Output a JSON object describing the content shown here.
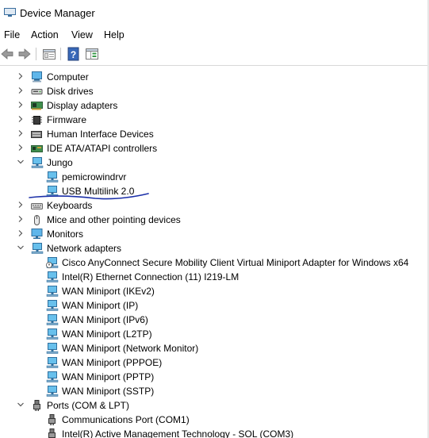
{
  "window": {
    "title": "Device Manager"
  },
  "menu": [
    "File",
    "Action",
    "View",
    "Help"
  ],
  "toolbar": {
    "buttons": [
      {
        "icon": "back-arrow-icon"
      },
      {
        "icon": "forward-arrow-icon"
      },
      {
        "icon": "properties-icon"
      },
      {
        "icon": "help-icon"
      },
      {
        "icon": "show-hidden-icon"
      }
    ]
  },
  "tree": [
    {
      "label": "Computer",
      "level": 0,
      "expander": "collapsed",
      "icon": "computer-icon"
    },
    {
      "label": "Disk drives",
      "level": 0,
      "expander": "collapsed",
      "icon": "disk-drive-icon"
    },
    {
      "label": "Display adapters",
      "level": 0,
      "expander": "collapsed",
      "icon": "display-adapter-icon"
    },
    {
      "label": "Firmware",
      "level": 0,
      "expander": "collapsed",
      "icon": "firmware-icon"
    },
    {
      "label": "Human Interface Devices",
      "level": 0,
      "expander": "collapsed",
      "icon": "hid-icon"
    },
    {
      "label": "IDE ATA/ATAPI controllers",
      "level": 0,
      "expander": "collapsed",
      "icon": "ide-controller-icon"
    },
    {
      "label": "Jungo",
      "level": 0,
      "expander": "expanded",
      "icon": "device-icon"
    },
    {
      "label": "pemicrowindrvr",
      "level": 1,
      "expander": "none",
      "icon": "device-icon"
    },
    {
      "label": "USB Multilink 2.0",
      "level": 1,
      "expander": "none",
      "icon": "device-icon"
    },
    {
      "label": "Keyboards",
      "level": 0,
      "expander": "collapsed",
      "icon": "keyboard-icon"
    },
    {
      "label": "Mice and other pointing devices",
      "level": 0,
      "expander": "collapsed",
      "icon": "mouse-icon"
    },
    {
      "label": "Monitors",
      "level": 0,
      "expander": "collapsed",
      "icon": "monitor-icon"
    },
    {
      "label": "Network adapters",
      "level": 0,
      "expander": "expanded",
      "icon": "network-adapter-icon"
    },
    {
      "label": "Cisco AnyConnect Secure Mobility Client Virtual Miniport Adapter for Windows x64",
      "level": 1,
      "expander": "none",
      "icon": "network-adapter-disabled-icon"
    },
    {
      "label": "Intel(R) Ethernet Connection (11) I219-LM",
      "level": 1,
      "expander": "none",
      "icon": "network-adapter-icon"
    },
    {
      "label": "WAN Miniport (IKEv2)",
      "level": 1,
      "expander": "none",
      "icon": "network-adapter-icon"
    },
    {
      "label": "WAN Miniport (IP)",
      "level": 1,
      "expander": "none",
      "icon": "network-adapter-icon"
    },
    {
      "label": "WAN Miniport (IPv6)",
      "level": 1,
      "expander": "none",
      "icon": "network-adapter-icon"
    },
    {
      "label": "WAN Miniport (L2TP)",
      "level": 1,
      "expander": "none",
      "icon": "network-adapter-icon"
    },
    {
      "label": "WAN Miniport (Network Monitor)",
      "level": 1,
      "expander": "none",
      "icon": "network-adapter-icon"
    },
    {
      "label": "WAN Miniport (PPPOE)",
      "level": 1,
      "expander": "none",
      "icon": "network-adapter-icon"
    },
    {
      "label": "WAN Miniport (PPTP)",
      "level": 1,
      "expander": "none",
      "icon": "network-adapter-icon"
    },
    {
      "label": "WAN Miniport (SSTP)",
      "level": 1,
      "expander": "none",
      "icon": "network-adapter-icon"
    },
    {
      "label": "Ports (COM & LPT)",
      "level": 0,
      "expander": "expanded",
      "icon": "port-icon"
    },
    {
      "label": "Communications Port (COM1)",
      "level": 1,
      "expander": "none",
      "icon": "port-icon"
    },
    {
      "label": "Intel(R) Active Management Technology - SOL (COM3)",
      "level": 1,
      "expander": "none",
      "icon": "port-icon"
    }
  ],
  "annotation": {
    "color": "#1b2fa8",
    "kind": "hand-drawn-underline"
  }
}
